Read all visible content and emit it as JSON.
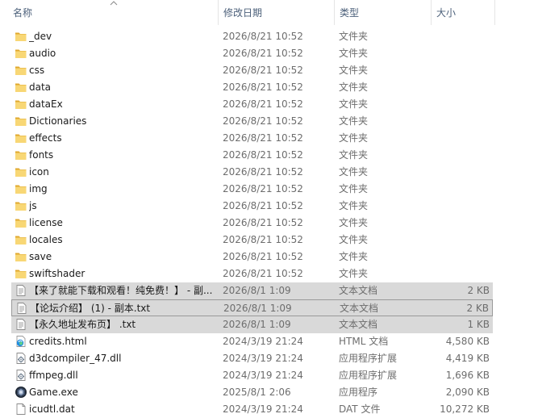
{
  "columns": {
    "name": "名称",
    "date": "修改日期",
    "type": "类型",
    "size": "大小"
  },
  "files": [
    {
      "name": "_dev",
      "date": "2026/8/21 10:52",
      "type": "文件夹",
      "size": "",
      "icon": "folder-icon",
      "selected": false
    },
    {
      "name": "audio",
      "date": "2026/8/21 10:52",
      "type": "文件夹",
      "size": "",
      "icon": "folder-icon",
      "selected": false
    },
    {
      "name": "css",
      "date": "2026/8/21 10:52",
      "type": "文件夹",
      "size": "",
      "icon": "folder-icon",
      "selected": false
    },
    {
      "name": "data",
      "date": "2026/8/21 10:52",
      "type": "文件夹",
      "size": "",
      "icon": "folder-icon",
      "selected": false
    },
    {
      "name": "dataEx",
      "date": "2026/8/21 10:52",
      "type": "文件夹",
      "size": "",
      "icon": "folder-icon",
      "selected": false
    },
    {
      "name": "Dictionaries",
      "date": "2026/8/21 10:52",
      "type": "文件夹",
      "size": "",
      "icon": "folder-icon",
      "selected": false
    },
    {
      "name": "effects",
      "date": "2026/8/21 10:52",
      "type": "文件夹",
      "size": "",
      "icon": "folder-icon",
      "selected": false
    },
    {
      "name": "fonts",
      "date": "2026/8/21 10:52",
      "type": "文件夹",
      "size": "",
      "icon": "folder-icon",
      "selected": false
    },
    {
      "name": "icon",
      "date": "2026/8/21 10:52",
      "type": "文件夹",
      "size": "",
      "icon": "folder-icon",
      "selected": false
    },
    {
      "name": "img",
      "date": "2026/8/21 10:52",
      "type": "文件夹",
      "size": "",
      "icon": "folder-icon",
      "selected": false
    },
    {
      "name": "js",
      "date": "2026/8/21 10:52",
      "type": "文件夹",
      "size": "",
      "icon": "folder-icon",
      "selected": false
    },
    {
      "name": "license",
      "date": "2026/8/21 10:52",
      "type": "文件夹",
      "size": "",
      "icon": "folder-icon",
      "selected": false
    },
    {
      "name": "locales",
      "date": "2026/8/21 10:52",
      "type": "文件夹",
      "size": "",
      "icon": "folder-icon",
      "selected": false
    },
    {
      "name": "save",
      "date": "2026/8/21 10:52",
      "type": "文件夹",
      "size": "",
      "icon": "folder-icon",
      "selected": false
    },
    {
      "name": "swiftshader",
      "date": "2026/8/21 10:52",
      "type": "文件夹",
      "size": "",
      "icon": "folder-icon",
      "selected": false
    },
    {
      "name": "【来了就能下载和观看！纯免费！】 - 副...",
      "date": "2026/8/1 1:09",
      "type": "文本文档",
      "size": "2 KB",
      "icon": "text-file-icon",
      "selected": true,
      "outline": false
    },
    {
      "name": "【论坛介绍】 (1) - 副本.txt",
      "date": "2026/8/1 1:09",
      "type": "文本文档",
      "size": "2 KB",
      "icon": "text-file-icon",
      "selected": true,
      "outline": true
    },
    {
      "name": "【永久地址发布页】 .txt",
      "date": "2026/8/1 1:09",
      "type": "文本文档",
      "size": "1 KB",
      "icon": "text-file-icon",
      "selected": true,
      "outline": false
    },
    {
      "name": "credits.html",
      "date": "2024/3/19 21:24",
      "type": "HTML 文档",
      "size": "4,580 KB",
      "icon": "edge-html-icon",
      "selected": false
    },
    {
      "name": "d3dcompiler_47.dll",
      "date": "2024/3/19 21:24",
      "type": "应用程序扩展",
      "size": "4,419 KB",
      "icon": "dll-file-icon",
      "selected": false
    },
    {
      "name": "ffmpeg.dll",
      "date": "2024/3/19 21:24",
      "type": "应用程序扩展",
      "size": "1,696 KB",
      "icon": "dll-file-icon",
      "selected": false
    },
    {
      "name": "Game.exe",
      "date": "2025/8/1 2:06",
      "type": "应用程序",
      "size": "2,090 KB",
      "icon": "app-exe-icon",
      "selected": false
    },
    {
      "name": "icudtl.dat",
      "date": "2024/3/19 21:24",
      "type": "DAT 文件",
      "size": "10,272 KB",
      "icon": "blank-file-icon",
      "selected": false
    }
  ],
  "colors": {
    "selected_bg": "#d9d9d9",
    "header_text": "#4c607a",
    "folder": "#f4c430"
  }
}
